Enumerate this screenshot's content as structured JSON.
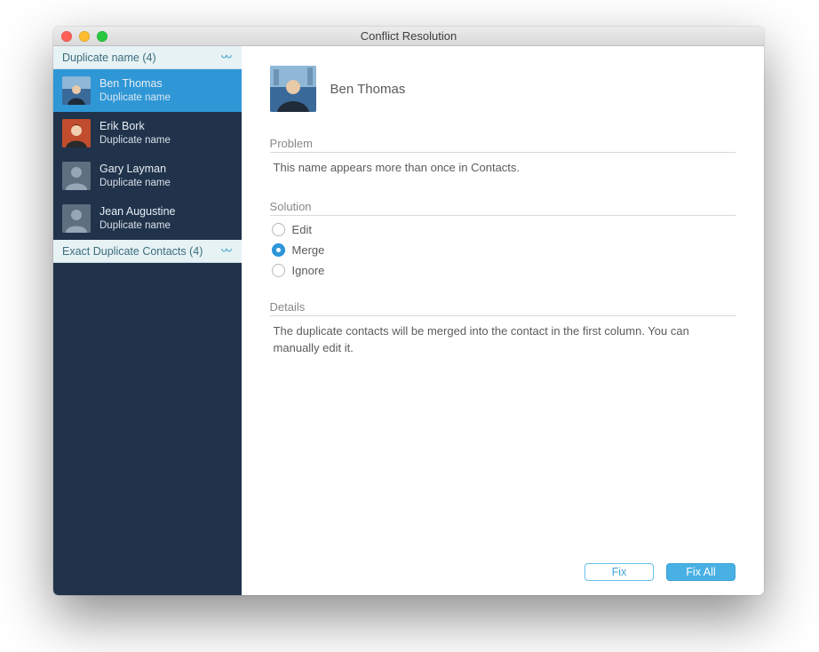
{
  "window": {
    "title": "Conflict Resolution"
  },
  "sidebar": {
    "groups": [
      {
        "label": "Duplicate name (4)"
      },
      {
        "label": "Exact Duplicate Contacts (4)"
      }
    ],
    "items": [
      {
        "name": "Ben Thomas",
        "sub": "Duplicate name",
        "selected": true,
        "avatar": "photo1"
      },
      {
        "name": "Erik Bork",
        "sub": "Duplicate name",
        "selected": false,
        "avatar": "photo2"
      },
      {
        "name": "Gary Layman",
        "sub": "Duplicate name",
        "selected": false,
        "avatar": "placeholder"
      },
      {
        "name": "Jean Augustine",
        "sub": "Duplicate name",
        "selected": false,
        "avatar": "placeholder"
      }
    ]
  },
  "detail": {
    "name": "Ben Thomas",
    "sections": {
      "problem": {
        "label": "Problem",
        "text": "This name appears more than once in Contacts."
      },
      "solution": {
        "label": "Solution"
      },
      "details": {
        "label": "Details",
        "text": "The duplicate contacts will be merged into the contact in the first column. You can manually edit it."
      }
    },
    "solutions": [
      {
        "label": "Edit",
        "checked": false
      },
      {
        "label": "Merge",
        "checked": true
      },
      {
        "label": "Ignore",
        "checked": false
      }
    ]
  },
  "buttons": {
    "fix": "Fix",
    "fixAll": "Fix All"
  }
}
